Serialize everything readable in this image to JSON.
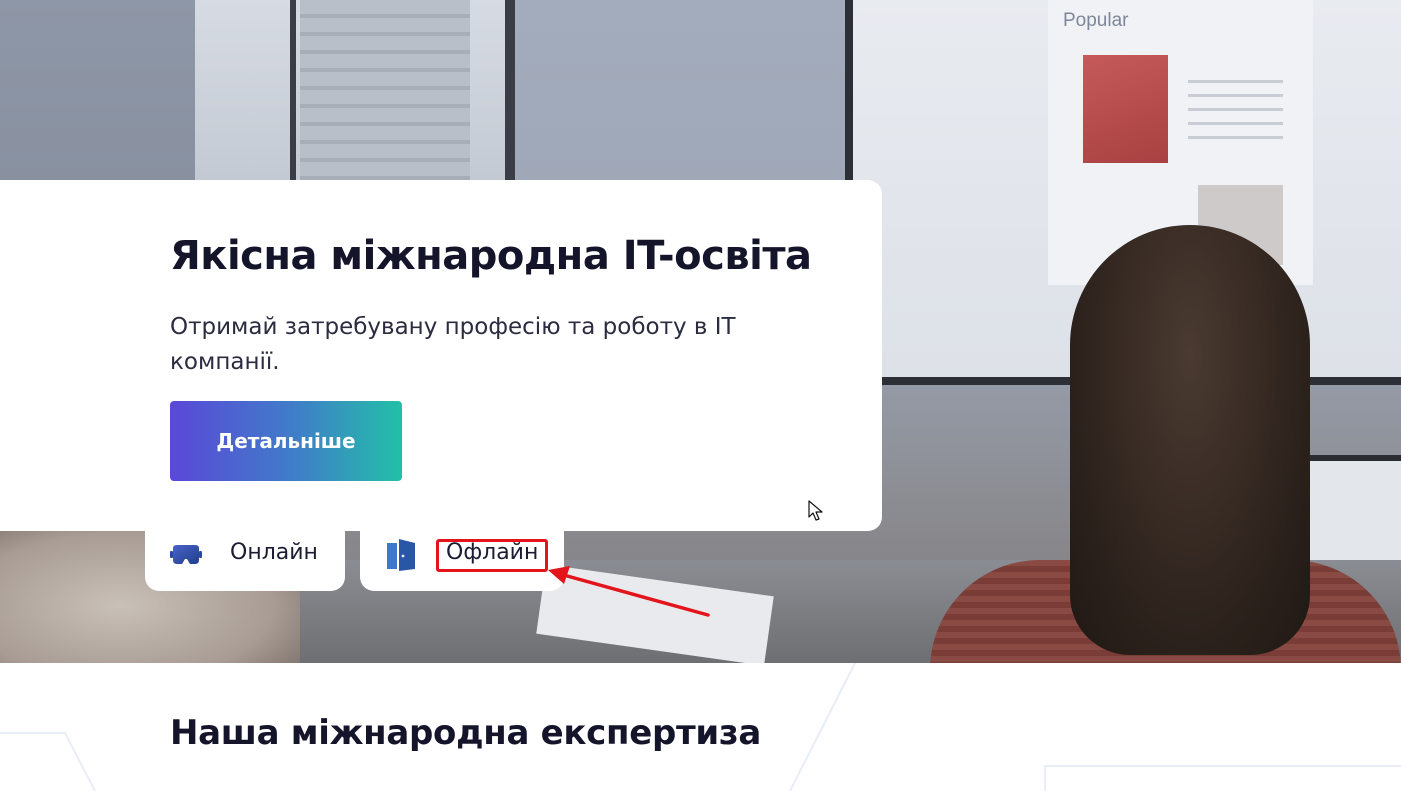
{
  "hero": {
    "screen_heading": "Popular",
    "card": {
      "title": "Якісна міжнародна IT-освіта",
      "subtitle": "Отримай затребувану професію та роботу в IT компанії.",
      "cta_label": "Детальніше"
    },
    "tabs": [
      {
        "label": "Онлайн",
        "icon": "vr-headset-icon",
        "icon_color": "#3f7fc8"
      },
      {
        "label": "Офлайн",
        "icon": "door-icon",
        "icon_color": "#3f7fc8"
      }
    ]
  },
  "annotation": {
    "highlight_color": "#e3141b"
  },
  "section": {
    "title": "Наша міжнародна експертиза"
  },
  "colors": {
    "cta_gradient_start": "#5a48d8",
    "cta_gradient_end": "#22c0a7",
    "text_dark": "#14152a"
  }
}
